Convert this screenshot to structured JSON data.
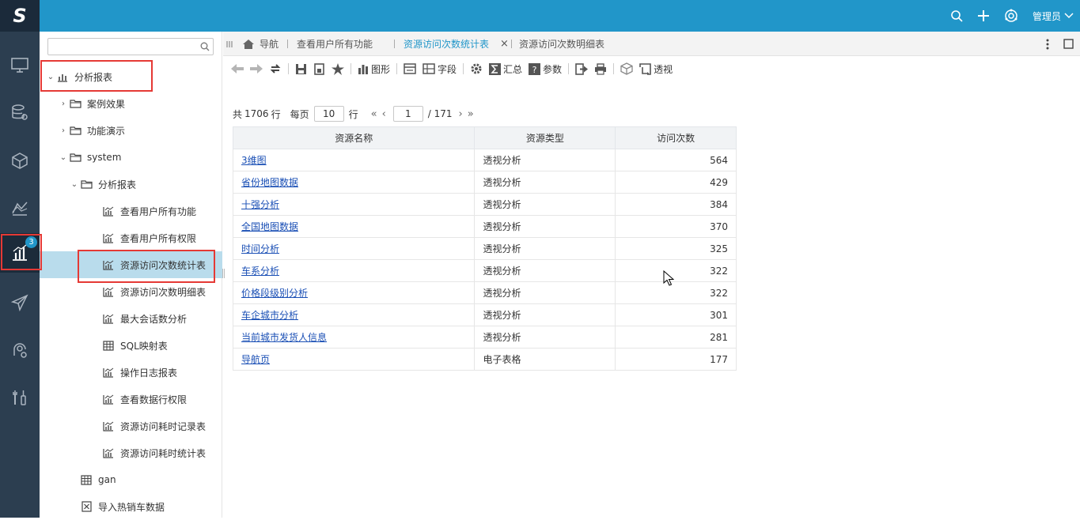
{
  "app": {
    "logo_letter": "S",
    "user_label": "管理员",
    "accent_color": "#2196c9",
    "nav_bg_color": "#2c3e50"
  },
  "leftnav": {
    "items": [
      {
        "icon": "monitor-icon"
      },
      {
        "icon": "database-settings-icon"
      },
      {
        "icon": "cube-icon"
      },
      {
        "icon": "chart-area-icon"
      },
      {
        "icon": "bar-chart-icon",
        "badge": "3",
        "active": true
      },
      {
        "icon": "paper-plane-icon"
      },
      {
        "icon": "settings-user-icon"
      },
      {
        "icon": "tools-icon"
      }
    ]
  },
  "tree": {
    "search_placeholder": "",
    "items": [
      {
        "label": "分析报表",
        "icon": "report-folder-icon",
        "arrow": "⌄"
      },
      {
        "label": "案例效果",
        "icon": "folder-icon",
        "arrow": "›"
      },
      {
        "label": "功能演示",
        "icon": "folder-icon",
        "arrow": "›"
      },
      {
        "label": "system",
        "icon": "folder-icon",
        "arrow": "⌄"
      },
      {
        "label": "分析报表",
        "icon": "folder-icon",
        "arrow": "⌄"
      },
      {
        "label": "查看用户所有功能",
        "icon": "line-chart-icon"
      },
      {
        "label": "查看用户所有权限",
        "icon": "line-chart-icon"
      },
      {
        "label": "资源访问次数统计表",
        "icon": "line-chart-icon",
        "selected": true
      },
      {
        "label": "资源访问次数明细表",
        "icon": "line-chart-icon"
      },
      {
        "label": "最大会话数分析",
        "icon": "line-chart-icon"
      },
      {
        "label": "SQL映射表",
        "icon": "table-icon"
      },
      {
        "label": "操作日志报表",
        "icon": "line-chart-icon"
      },
      {
        "label": "查看数据行权限",
        "icon": "line-chart-icon"
      },
      {
        "label": "资源访问耗时记录表",
        "icon": "line-chart-icon"
      },
      {
        "label": "资源访问耗时统计表",
        "icon": "line-chart-icon"
      },
      {
        "label": "gan",
        "icon": "table-icon"
      },
      {
        "label": "导入热销车数据",
        "icon": "import-icon"
      }
    ]
  },
  "tabs": {
    "home": "导航",
    "items": [
      {
        "label": "查看用户所有功能"
      },
      {
        "label": "资源访问次数统计表",
        "active": true,
        "close": "×"
      },
      {
        "label": "资源访问次数明细表"
      }
    ]
  },
  "toolbar": {
    "graph": "图形",
    "field": "字段",
    "summary": "汇总",
    "param": "参数",
    "pivot": "透视"
  },
  "pager": {
    "total_prefix": "共",
    "total": "1706",
    "total_unit": "行",
    "per_page_label": "每页",
    "per_page": "10",
    "per_page_unit": "行",
    "current_page": "1",
    "page_count": "/ 171"
  },
  "table": {
    "headers": [
      "资源名称",
      "资源类型",
      "访问次数"
    ],
    "rows": [
      {
        "name": "3维图",
        "type": "透视分析",
        "count": "564"
      },
      {
        "name": "省份地图数据",
        "type": "透视分析",
        "count": "429"
      },
      {
        "name": "十强分析",
        "type": "透视分析",
        "count": "384"
      },
      {
        "name": "全国地图数据",
        "type": "透视分析",
        "count": "370"
      },
      {
        "name": "时间分析",
        "type": "透视分析",
        "count": "325"
      },
      {
        "name": "车系分析",
        "type": "透视分析",
        "count": "322"
      },
      {
        "name": "价格段级别分析",
        "type": "透视分析",
        "count": "322"
      },
      {
        "name": "车企城市分析",
        "type": "透视分析",
        "count": "301"
      },
      {
        "name": "当前城市发货人信息",
        "type": "透视分析",
        "count": "281"
      },
      {
        "name": "导航页",
        "type": "电子表格",
        "count": "177"
      }
    ]
  }
}
